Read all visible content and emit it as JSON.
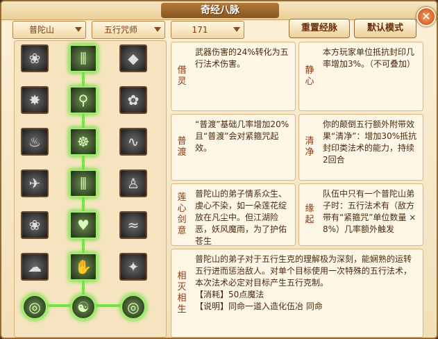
{
  "window": {
    "title": "奇经八脉",
    "close_label": "✕"
  },
  "filters": {
    "school": "普陀山",
    "category": "五行咒师",
    "level": "171"
  },
  "buttons": {
    "reset": "重置经脉",
    "default_mode": "默认模式"
  },
  "skill_icons": [
    {
      "name": "lotus-icon",
      "active": false
    },
    {
      "name": "bamboo-icon",
      "active": true
    },
    {
      "name": "dark-scroll-icon",
      "active": false
    },
    {
      "name": "burst-icon",
      "active": false
    },
    {
      "name": "staff-icon",
      "active": true
    },
    {
      "name": "lotus-bloom-icon",
      "active": false
    },
    {
      "name": "flame-lotus-icon",
      "active": false
    },
    {
      "name": "meditate-icon",
      "active": true
    },
    {
      "name": "serpent-icon",
      "active": false
    },
    {
      "name": "crane-icon",
      "active": false
    },
    {
      "name": "bamboo-grove-icon",
      "active": true
    },
    {
      "name": "figure-icon",
      "active": false
    },
    {
      "name": "dark-lotus-icon",
      "active": false
    },
    {
      "name": "hearts-icon",
      "active": true
    },
    {
      "name": "wave-icon",
      "active": false
    },
    {
      "name": "cloud-icon",
      "active": false
    },
    {
      "name": "hand-icon",
      "active": true
    },
    {
      "name": "pentagram-icon",
      "active": false
    },
    {
      "name": "wheel-left-icon",
      "active": true
    },
    {
      "name": "taiji-icon",
      "active": true
    },
    {
      "name": "wheel-right-icon",
      "active": true
    }
  ],
  "cards": [
    {
      "name": "借灵",
      "text": "武器伤害的24%转化为五行法术伤害。"
    },
    {
      "name": "静心",
      "text": "本方玩家单位抵抗封印几率增加3%。（不可叠加）"
    },
    {
      "name": "普渡",
      "text": "“普渡”基础几率增加20%且“普渡”会对紧箍咒起效。"
    },
    {
      "name": "清净",
      "text": "你的颠倒五行额外附带效果“清净”：增加30%抵抗封印类法术的能力，持续2回合"
    },
    {
      "name": "莲心剑意",
      "text": "普陀山的弟子情系众生、虔心不染，如一朵莲花绽放在凡尘中。但江湖险恶，妖风魔雨，为了护佑苍生"
    },
    {
      "name": "缘起",
      "text": "队伍中只有一个普陀山弟子时：五行法术有（敌方带有“紧箍咒”单位数量 × 8%）几率额外触发"
    },
    {
      "name": "相灭相生",
      "text": "普陀山的弟子对于五行生克的理解极为深刻，能娴熟的运转五行进而惩治敌人。对单个目标使用一次特殊的五行法术，本次法术必定对目标产生五行克制。",
      "cost": "【消耗】50点魔法",
      "extra": "【说明】同命一道入造化伍冶 同命"
    }
  ]
}
